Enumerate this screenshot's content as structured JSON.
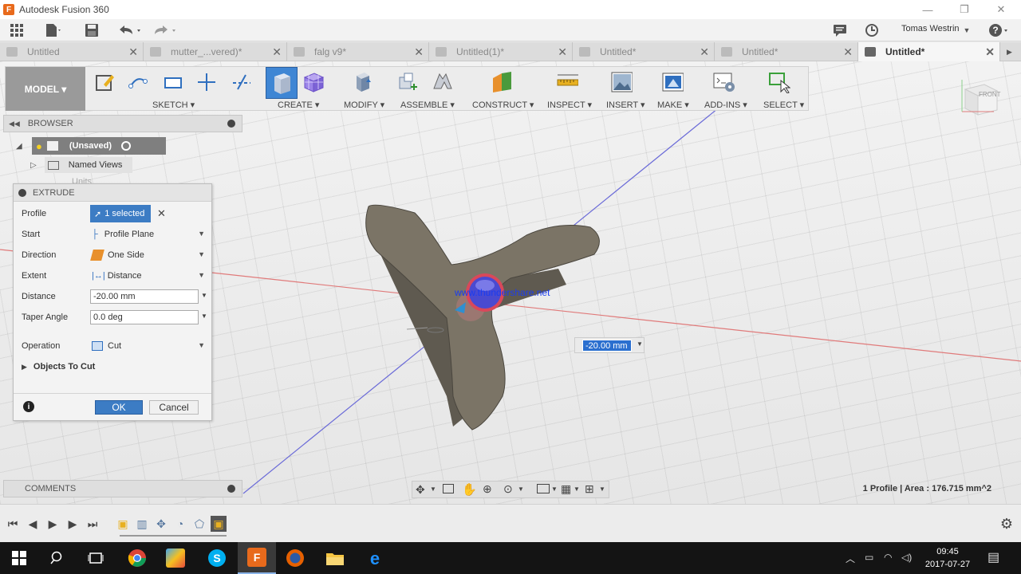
{
  "window": {
    "title": "Autodesk Fusion 360",
    "minimize": "—",
    "restore": "❐",
    "close": "✕"
  },
  "appbar": {
    "user": "Tomas Westrin"
  },
  "tabs": [
    {
      "label": "Untitled"
    },
    {
      "label": "mutter_...vered)*"
    },
    {
      "label": "falg v9*"
    },
    {
      "label": "Untitled(1)*"
    },
    {
      "label": "Untitled*"
    },
    {
      "label": "Untitled*"
    },
    {
      "label": "Untitled*",
      "active": true
    }
  ],
  "toolbar": {
    "workspace": "MODEL ▾",
    "groups": [
      "SKETCH ▾",
      "CREATE ▾",
      "MODIFY ▾",
      "ASSEMBLE ▾",
      "CONSTRUCT ▾",
      "INSPECT ▾",
      "INSERT ▾",
      "MAKE ▾",
      "ADD-INS ▾",
      "SELECT ▾"
    ]
  },
  "browser": {
    "title": "BROWSER",
    "root": "(Unsaved)",
    "named_views": "Named Views",
    "partial_item": "Units"
  },
  "extrude": {
    "title": "EXTRUDE",
    "profile_label": "Profile",
    "profile_value": "1 selected",
    "start_label": "Start",
    "start_value": "Profile Plane",
    "direction_label": "Direction",
    "direction_value": "One Side",
    "extent_label": "Extent",
    "extent_value": "Distance",
    "distance_label": "Distance",
    "distance_value": "-20.00 mm",
    "taper_label": "Taper Angle",
    "taper_value": "0.0 deg",
    "operation_label": "Operation",
    "operation_value": "Cut",
    "objects_to_cut": "Objects To Cut",
    "ok": "OK",
    "cancel": "Cancel"
  },
  "viewport": {
    "watermark": "www.thundershare.net",
    "distance_manipulator": "-20.00 mm",
    "viewcube_label": "FRONT"
  },
  "comments": {
    "title": "COMMENTS"
  },
  "status": {
    "selection_info": "1 Profile | Area : 176.715 mm^2"
  },
  "taskbar": {
    "time": "09:45",
    "date": "2017-07-27"
  },
  "colors": {
    "accent": "#3a7cc0",
    "model_bg": "#9a9a9a",
    "taskbar": "#141414",
    "part_face": "#7b7466",
    "part_side": "#5f5a50",
    "red_axis": "#e07a7a",
    "blue_axis": "#6b6bd8"
  }
}
